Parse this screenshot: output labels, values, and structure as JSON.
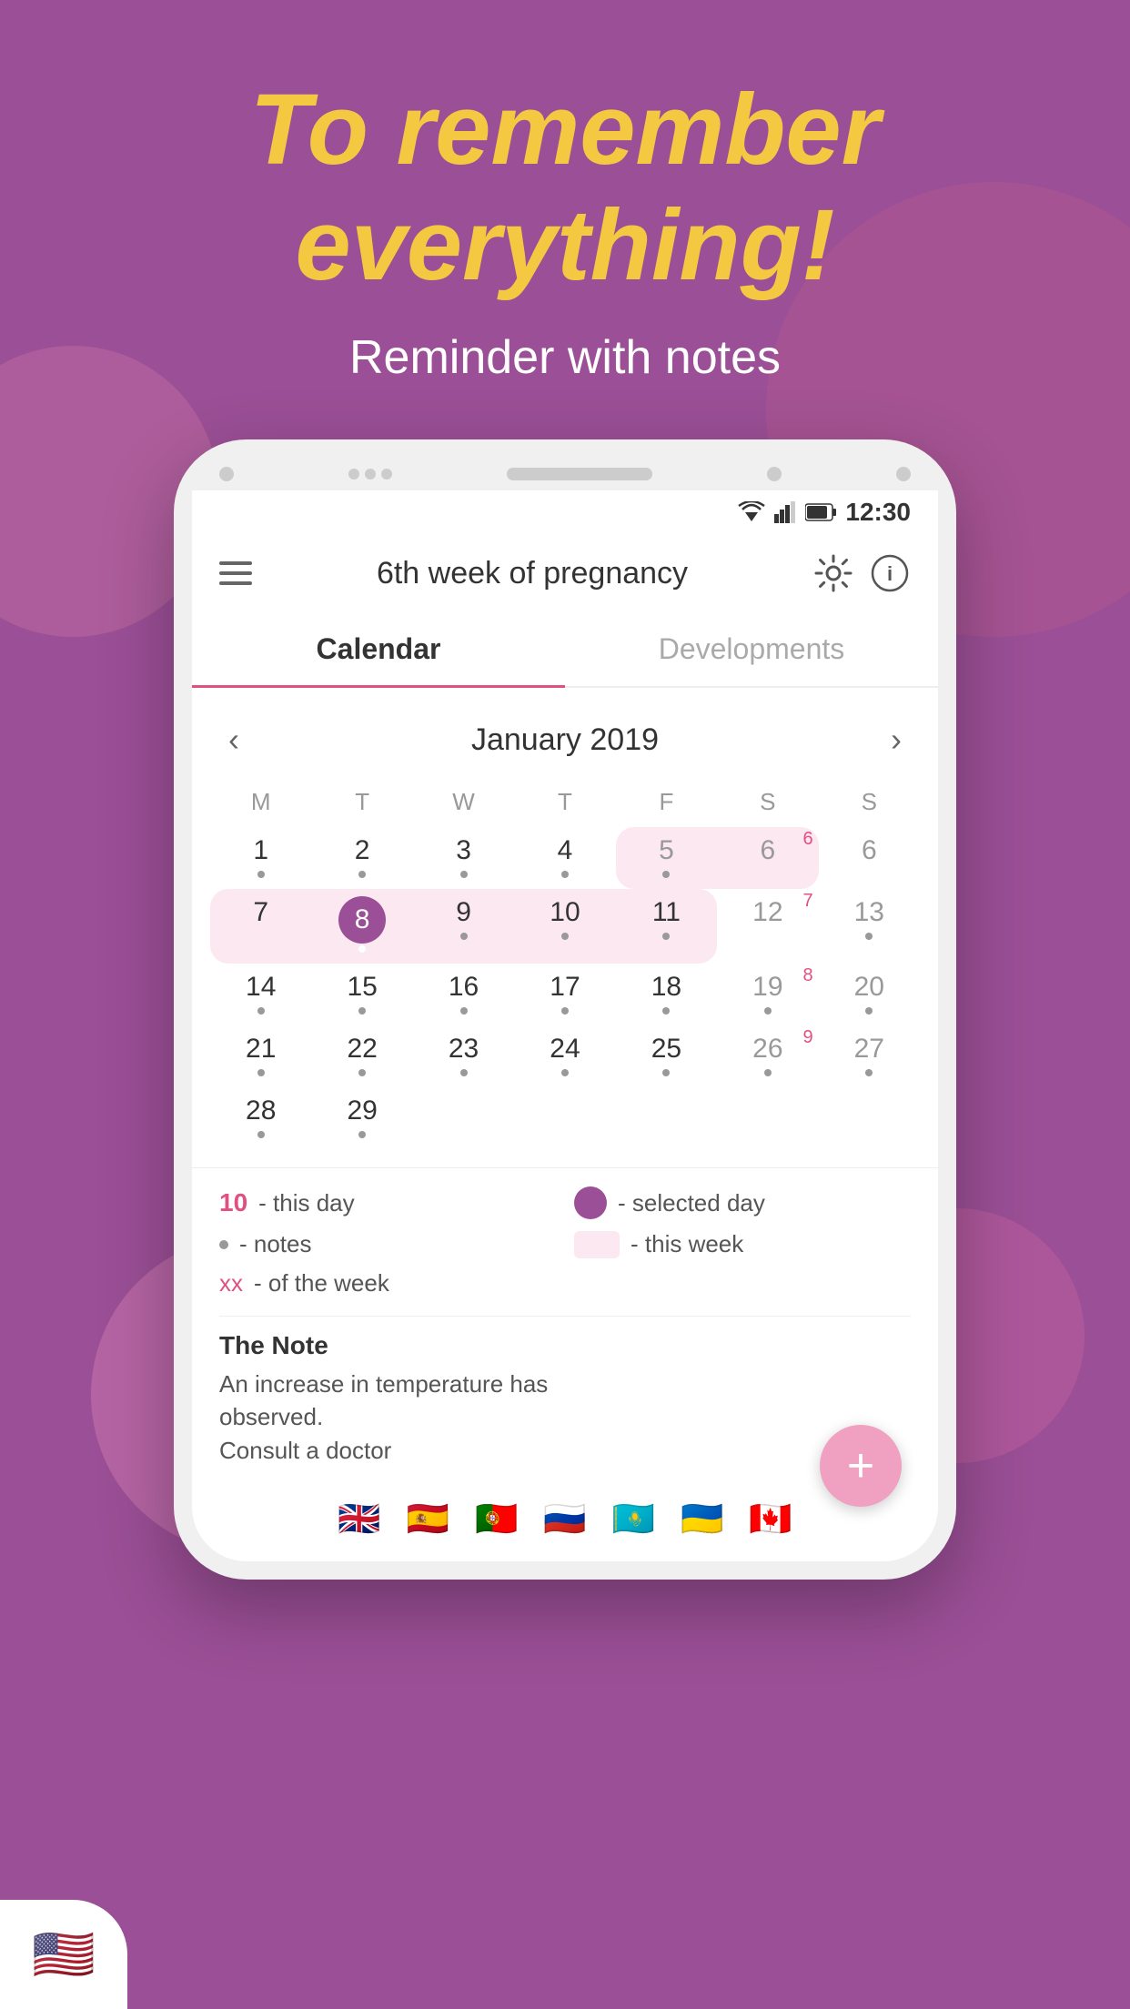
{
  "hero": {
    "title_line1": "To remember",
    "title_line2": "everything!",
    "subtitle": "Reminder with notes"
  },
  "status_bar": {
    "time": "12:30"
  },
  "app_header": {
    "title": "6th week of pregnancy"
  },
  "tabs": [
    {
      "label": "Calendar",
      "active": true
    },
    {
      "label": "Developments",
      "active": false
    }
  ],
  "calendar": {
    "month_label": "January 2019",
    "day_headers": [
      "M",
      "T",
      "W",
      "T",
      "F",
      "S",
      "S"
    ],
    "weeks": [
      [
        {
          "day": "1",
          "dot": true,
          "empty": false,
          "weekend": false,
          "this_week": false,
          "selected": false
        },
        {
          "day": "2",
          "dot": true,
          "empty": false,
          "weekend": false,
          "this_week": false,
          "selected": false
        },
        {
          "day": "3",
          "dot": true,
          "empty": false,
          "weekend": false,
          "this_week": false,
          "selected": false
        },
        {
          "day": "4",
          "dot": true,
          "empty": false,
          "weekend": false,
          "this_week": false,
          "selected": false
        },
        {
          "day": "5",
          "dot": true,
          "empty": false,
          "weekend": true,
          "this_week": true,
          "selected": false
        },
        {
          "day": "6",
          "dot": false,
          "week_num": "6",
          "empty": false,
          "weekend": true,
          "this_week": true,
          "selected": false
        },
        {
          "day": "6",
          "dot": false,
          "empty": false,
          "weekend": true,
          "this_week": false,
          "selected": false
        }
      ],
      [
        {
          "day": "7",
          "dot": false,
          "empty": false,
          "weekend": false,
          "this_week": true,
          "selected": false
        },
        {
          "day": "8",
          "dot": true,
          "empty": false,
          "weekend": false,
          "this_week": true,
          "selected": true
        },
        {
          "day": "9",
          "dot": true,
          "empty": false,
          "weekend": false,
          "this_week": true,
          "selected": false
        },
        {
          "day": "10",
          "dot": true,
          "empty": false,
          "weekend": false,
          "this_week": true,
          "selected": false
        },
        {
          "day": "11",
          "dot": true,
          "empty": false,
          "weekend": false,
          "this_week": true,
          "selected": false
        },
        {
          "day": "12",
          "dot": false,
          "week_num": "7",
          "empty": false,
          "weekend": true,
          "this_week": false,
          "selected": false
        },
        {
          "day": "13",
          "dot": true,
          "empty": false,
          "weekend": true,
          "this_week": false,
          "selected": false
        }
      ],
      [
        {
          "day": "14",
          "dot": true,
          "empty": false,
          "weekend": false,
          "this_week": false,
          "selected": false
        },
        {
          "day": "15",
          "dot": true,
          "empty": false,
          "weekend": false,
          "this_week": false,
          "selected": false
        },
        {
          "day": "16",
          "dot": true,
          "empty": false,
          "weekend": false,
          "this_week": false,
          "selected": false
        },
        {
          "day": "17",
          "dot": true,
          "empty": false,
          "weekend": false,
          "this_week": false,
          "selected": false
        },
        {
          "day": "18",
          "dot": true,
          "empty": false,
          "weekend": false,
          "this_week": false,
          "selected": false
        },
        {
          "day": "19",
          "dot": true,
          "week_num": "8",
          "empty": false,
          "weekend": true,
          "this_week": false,
          "selected": false
        },
        {
          "day": "20",
          "dot": true,
          "empty": false,
          "weekend": true,
          "this_week": false,
          "selected": false
        }
      ],
      [
        {
          "day": "21",
          "dot": true,
          "empty": false,
          "weekend": false,
          "this_week": false,
          "selected": false
        },
        {
          "day": "22",
          "dot": true,
          "empty": false,
          "weekend": false,
          "this_week": false,
          "selected": false
        },
        {
          "day": "23",
          "dot": true,
          "empty": false,
          "weekend": false,
          "this_week": false,
          "selected": false
        },
        {
          "day": "24",
          "dot": true,
          "empty": false,
          "weekend": false,
          "this_week": false,
          "selected": false
        },
        {
          "day": "25",
          "dot": true,
          "empty": false,
          "weekend": false,
          "this_week": false,
          "selected": false
        },
        {
          "day": "26",
          "dot": true,
          "week_num": "9",
          "empty": false,
          "weekend": true,
          "this_week": false,
          "selected": false
        },
        {
          "day": "27",
          "dot": true,
          "empty": false,
          "weekend": true,
          "this_week": false,
          "selected": false
        }
      ],
      [
        {
          "day": "28",
          "dot": true,
          "empty": false,
          "weekend": false,
          "this_week": false,
          "selected": false
        },
        {
          "day": "29",
          "dot": true,
          "empty": false,
          "weekend": false,
          "this_week": false,
          "selected": false
        },
        {
          "day": "",
          "dot": false,
          "empty": true
        },
        {
          "day": "",
          "dot": false,
          "empty": true
        },
        {
          "day": "",
          "dot": false,
          "empty": true
        },
        {
          "day": "",
          "dot": false,
          "empty": true
        },
        {
          "day": "",
          "dot": false,
          "empty": true
        }
      ]
    ]
  },
  "legend": {
    "this_day_label": "- this day",
    "notes_label": "- notes",
    "week_label": "- of the week",
    "selected_day_label": "- selected day",
    "this_week_label": "- this week",
    "this_day_num": "10",
    "week_num_example": "xx"
  },
  "note": {
    "title": "The Note",
    "text_line1": "An increase in temperature has",
    "text_line2": "observed.",
    "text_line3": "Consult a doctor"
  },
  "fab": {
    "label": "+"
  },
  "flags": [
    "🇬🇧",
    "🇪🇸",
    "🇵🇹",
    "🇷🇺",
    "🇰🇿",
    "🇺🇦",
    "🇨🇦"
  ],
  "bottom_flag": "🇺🇸"
}
